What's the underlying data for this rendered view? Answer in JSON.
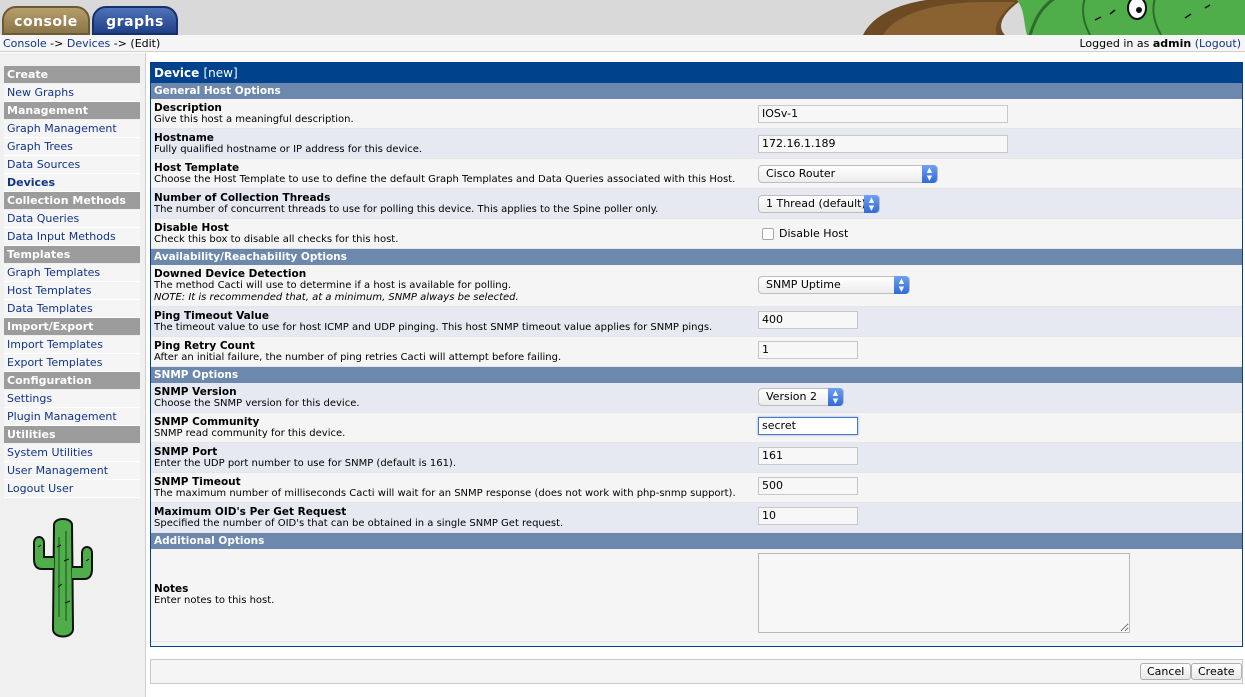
{
  "tabs": {
    "console": "console",
    "graphs": "graphs"
  },
  "breadcrumb": {
    "console": "Console",
    "sep1": " -> ",
    "devices": "Devices",
    "sep2": " -> ",
    "current": "(Edit)"
  },
  "login": {
    "prefix": "Logged in as ",
    "user": "admin",
    "logout": "(Logout)"
  },
  "sidebar": {
    "groups": [
      {
        "heading": "Create",
        "items": [
          "New Graphs"
        ]
      },
      {
        "heading": "Management",
        "items": [
          "Graph Management",
          "Graph Trees",
          "Data Sources",
          "Devices"
        ]
      },
      {
        "heading": "Collection Methods",
        "items": [
          "Data Queries",
          "Data Input Methods"
        ]
      },
      {
        "heading": "Templates",
        "items": [
          "Graph Templates",
          "Host Templates",
          "Data Templates"
        ]
      },
      {
        "heading": "Import/Export",
        "items": [
          "Import Templates",
          "Export Templates"
        ]
      },
      {
        "heading": "Configuration",
        "items": [
          "Settings",
          "Plugin Management"
        ]
      },
      {
        "heading": "Utilities",
        "items": [
          "System Utilities",
          "User Management",
          "Logout User"
        ]
      }
    ],
    "active": "Devices"
  },
  "form": {
    "title": "Device",
    "title_sub": "[new]",
    "sections": {
      "general": "General Host Options",
      "availability": "Availability/Reachability Options",
      "snmp": "SNMP Options",
      "additional": "Additional Options"
    },
    "description": {
      "name": "Description",
      "desc": "Give this host a meaningful description.",
      "value": "IOSv-1"
    },
    "hostname": {
      "name": "Hostname",
      "desc": "Fully qualified hostname or IP address for this device.",
      "value": "172.16.1.189"
    },
    "host_template": {
      "name": "Host Template",
      "desc": "Choose the Host Template to use to define the default Graph Templates and Data Queries associated with this Host.",
      "value": "Cisco Router"
    },
    "threads": {
      "name": "Number of Collection Threads",
      "desc": "The number of concurrent threads to use for polling this device. This applies to the Spine poller only.",
      "value": "1 Thread (default)"
    },
    "disable": {
      "name": "Disable Host",
      "desc": "Check this box to disable all checks for this host.",
      "label": "Disable Host",
      "checked": false
    },
    "downed": {
      "name": "Downed Device Detection",
      "desc": "The method Cacti will use to determine if a host is available for polling.",
      "note": "NOTE: It is recommended that, at a minimum, SNMP always be selected.",
      "value": "SNMP Uptime"
    },
    "ping_timeout": {
      "name": "Ping Timeout Value",
      "desc": "The timeout value to use for host ICMP and UDP pinging. This host SNMP timeout value applies for SNMP pings.",
      "value": "400"
    },
    "ping_retry": {
      "name": "Ping Retry Count",
      "desc": "After an initial failure, the number of ping retries Cacti will attempt before failing.",
      "value": "1"
    },
    "snmp_version": {
      "name": "SNMP Version",
      "desc": "Choose the SNMP version for this device.",
      "value": "Version 2"
    },
    "snmp_community": {
      "name": "SNMP Community",
      "desc": "SNMP read community for this device.",
      "value": "secret"
    },
    "snmp_port": {
      "name": "SNMP Port",
      "desc": "Enter the UDP port number to use for SNMP (default is 161).",
      "value": "161"
    },
    "snmp_timeout": {
      "name": "SNMP Timeout",
      "desc": "The maximum number of milliseconds Cacti will wait for an SNMP response (does not work with php-snmp support).",
      "value": "500"
    },
    "max_oids": {
      "name": "Maximum OID's Per Get Request",
      "desc": "Specified the number of OID's that can be obtained in a single SNMP Get request.",
      "value": "10"
    },
    "notes": {
      "name": "Notes",
      "desc": "Enter notes to this host.",
      "value": ""
    }
  },
  "buttons": {
    "cancel": "Cancel",
    "create": "Create"
  },
  "colors": {
    "header_blue": "#00438c",
    "section_blue": "#6d88ad",
    "link": "#113388"
  }
}
